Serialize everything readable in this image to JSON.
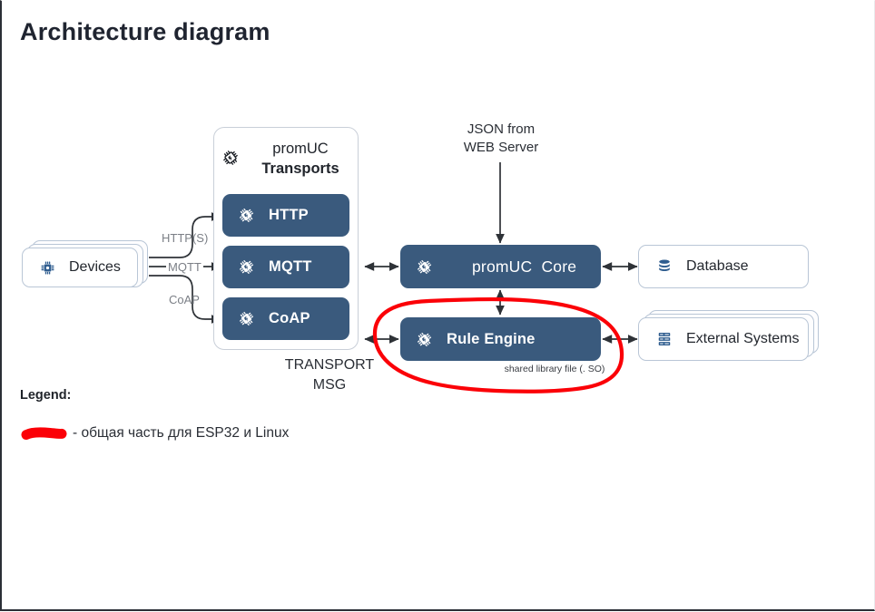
{
  "page": {
    "title": "Architecture diagram",
    "background": "#ffffff",
    "accent_dark": "#3a5a7d",
    "accent_red": "#fb0007"
  },
  "nodes": {
    "devices": {
      "label": "Devices",
      "icon": "microchip-icon",
      "stacked": true
    },
    "transports_container": {
      "title_line1": "promUC",
      "title_line2": "Transports",
      "icon": "microchip-outline-icon",
      "items": [
        {
          "label": "HTTP",
          "icon": "microchip-icon"
        },
        {
          "label": "MQTT",
          "icon": "microchip-icon"
        },
        {
          "label": "CoAP",
          "icon": "microchip-icon"
        }
      ]
    },
    "core": {
      "label": "promUC  Core",
      "icon": "microchip-icon"
    },
    "rule_engine": {
      "label": "Rule Engine",
      "icon": "microchip-icon",
      "caption": "shared library file (. SO)"
    },
    "database": {
      "label": "Database",
      "icon": "database-icon"
    },
    "external_systems": {
      "label": "External Systems",
      "icon": "server-rack-icon",
      "stacked": true
    }
  },
  "annotations": {
    "json_source_line1": "JSON from",
    "json_source_line2": "WEB Server",
    "transport_msg_line1": "TRANSPORT",
    "transport_msg_line2": "MSG",
    "edge_https": "HTTP(S)",
    "edge_mqtt": "MQTT",
    "edge_coap": "CoAP"
  },
  "legend": {
    "title": "Legend:",
    "swatch_color": "#fb0007",
    "text": "- общая часть для ESP32 и Linux"
  }
}
